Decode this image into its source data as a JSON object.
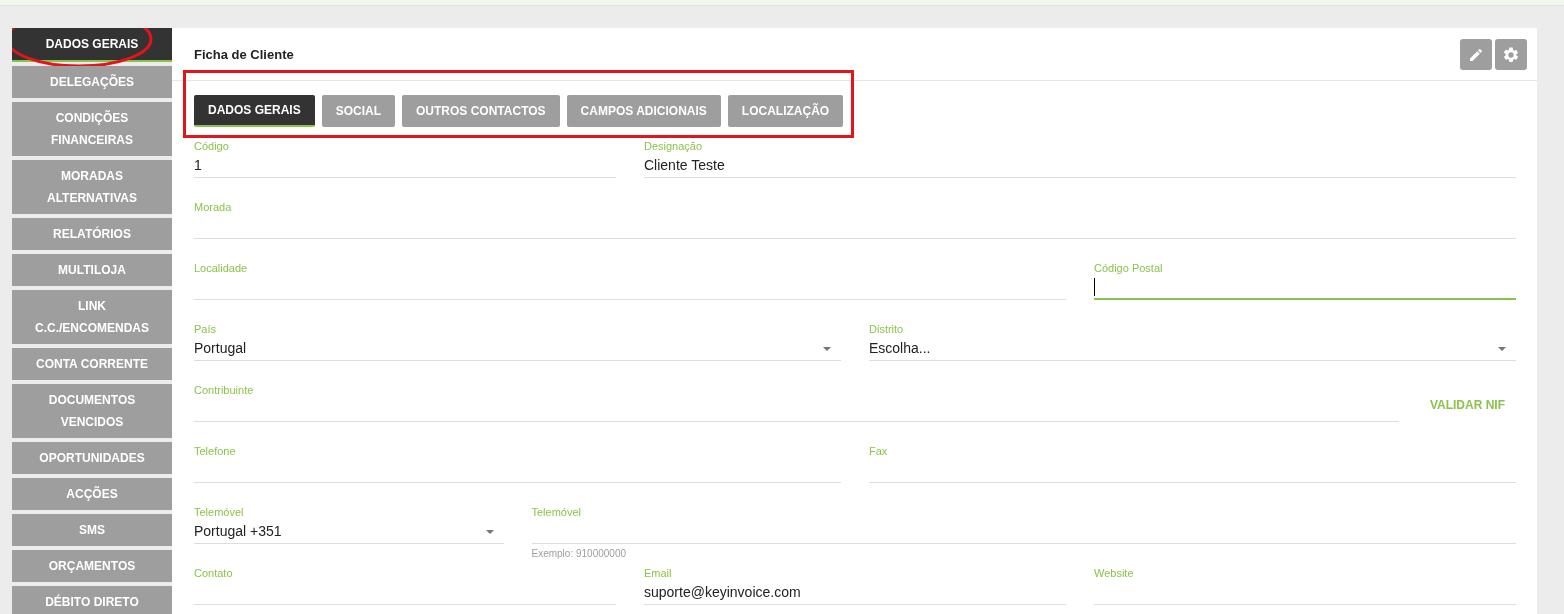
{
  "sidebar": {
    "items": [
      {
        "label": "DADOS GERAIS",
        "selected": true,
        "circled": true
      },
      {
        "label": "DELEGAÇÕES",
        "selected": false,
        "circled": false
      },
      {
        "label": "CONDIÇÕES FINANCEIRAS",
        "selected": false,
        "circled": false
      },
      {
        "label": "MORADAS ALTERNATIVAS",
        "selected": false,
        "circled": false
      },
      {
        "label": "RELATÓRIOS",
        "selected": false,
        "circled": false
      },
      {
        "label": "MULTILOJA",
        "selected": false,
        "circled": false
      },
      {
        "label": "LINK C.C./ENCOMENDAS",
        "selected": false,
        "circled": false
      },
      {
        "label": "CONTA CORRENTE",
        "selected": false,
        "circled": false
      },
      {
        "label": "DOCUMENTOS VENCIDOS",
        "selected": false,
        "circled": false
      },
      {
        "label": "OPORTUNIDADES",
        "selected": false,
        "circled": false
      },
      {
        "label": "ACÇÕES",
        "selected": false,
        "circled": false
      },
      {
        "label": "SMS",
        "selected": false,
        "circled": false
      },
      {
        "label": "ORÇAMENTOS",
        "selected": false,
        "circled": false
      },
      {
        "label": "DÉBITO DIRETO",
        "selected": false,
        "circled": false
      }
    ]
  },
  "panel": {
    "title": "Ficha de Cliente",
    "tab_bar": {
      "highlighted": true,
      "tabs": [
        {
          "label": "DADOS GERAIS",
          "selected": true
        },
        {
          "label": "SOCIAL",
          "selected": false
        },
        {
          "label": "OUTROS CONTACTOS",
          "selected": false
        },
        {
          "label": "CAMPOS ADICIONAIS",
          "selected": false
        },
        {
          "label": "LOCALIZAÇÃO",
          "selected": false
        }
      ]
    },
    "form_rows": [
      [
        {
          "kind": "text",
          "label": "Código",
          "value": "1",
          "focused": false
        },
        {
          "kind": "text",
          "label": "Designação",
          "value": "Cliente Teste",
          "focused": false
        }
      ],
      [
        {
          "kind": "text",
          "label": "Morada",
          "focused": false
        }
      ],
      [
        {
          "kind": "text",
          "label": "Localidade",
          "focused": false
        },
        {
          "kind": "text",
          "label": "Código Postal",
          "focused": true
        }
      ],
      [
        {
          "kind": "select",
          "label": "País",
          "value": "Portugal",
          "focused": false
        },
        {
          "kind": "select",
          "label": "Distrito",
          "value": "Escolha...",
          "focused": false
        }
      ],
      [
        {
          "kind": "text",
          "label": "Contribuinte",
          "action": "VALIDAR NIF",
          "focused": false
        }
      ],
      [
        {
          "kind": "text",
          "label": "Telefone",
          "focused": false
        },
        {
          "kind": "text",
          "label": "Fax",
          "focused": false
        }
      ],
      [
        {
          "kind": "select",
          "label": "Telemóvel",
          "value": "Portugal +351",
          "focused": false
        },
        {
          "kind": "text",
          "label": "Telemóvel",
          "hint": "Exemplo: 910000000",
          "focused": false
        }
      ],
      [
        {
          "kind": "text",
          "label": "Contato",
          "focused": false
        },
        {
          "kind": "text",
          "label": "Email",
          "value": "suporte@keyinvoice.com",
          "focused": false
        },
        {
          "kind": "text",
          "label": "Website",
          "focused": false
        }
      ]
    ]
  }
}
